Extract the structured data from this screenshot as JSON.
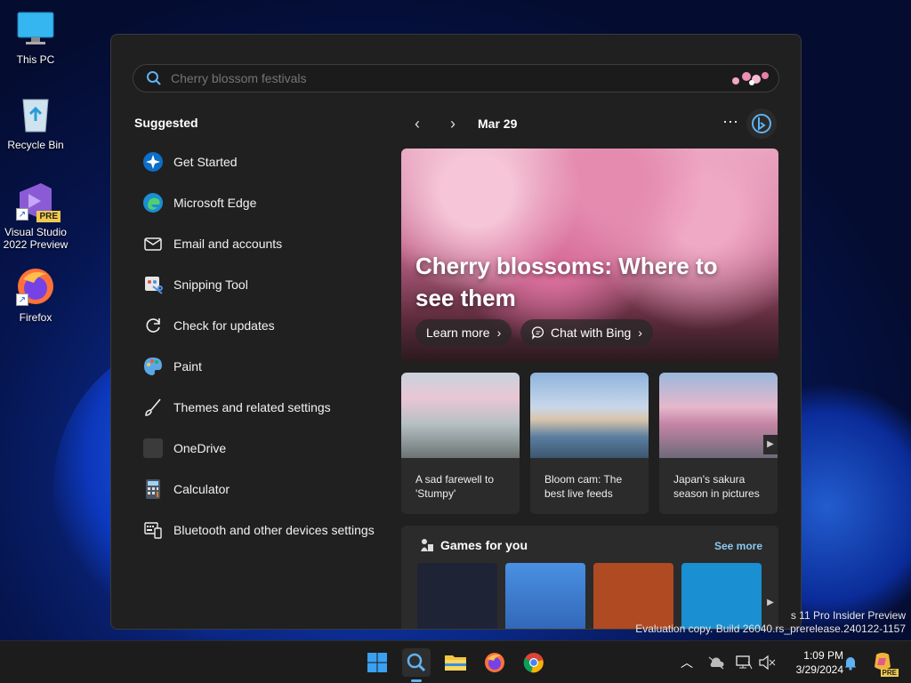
{
  "desktop": {
    "icons": [
      {
        "label": "This PC"
      },
      {
        "label": "Recycle Bin"
      },
      {
        "label": "Visual Studio 2022 Preview",
        "badge": "PRE"
      },
      {
        "label": "Firefox"
      }
    ]
  },
  "search": {
    "value": "",
    "placeholder": "Cherry blossom festivals"
  },
  "suggested": {
    "title": "Suggested",
    "items": [
      {
        "label": "Get Started",
        "icon": "get-started-icon"
      },
      {
        "label": "Microsoft Edge",
        "icon": "edge-icon"
      },
      {
        "label": "Email and accounts",
        "icon": "mail-icon"
      },
      {
        "label": "Snipping Tool",
        "icon": "snipping-tool-icon"
      },
      {
        "label": "Check for updates",
        "icon": "refresh-icon"
      },
      {
        "label": "Paint",
        "icon": "paint-icon"
      },
      {
        "label": "Themes and related settings",
        "icon": "brush-icon"
      },
      {
        "label": "OneDrive",
        "icon": "onedrive-icon"
      },
      {
        "label": "Calculator",
        "icon": "calculator-icon"
      },
      {
        "label": "Bluetooth and other devices settings",
        "icon": "devices-icon"
      }
    ]
  },
  "feed": {
    "date": "Mar 29",
    "more": "···",
    "hero": {
      "title": "Cherry blossoms: Where to see them",
      "learn_more": "Learn more",
      "chat_with_bing": "Chat with Bing"
    },
    "cards": [
      {
        "caption": "A sad farewell to 'Stumpy'"
      },
      {
        "caption": "Bloom cam: The best live feeds"
      },
      {
        "caption": "Japan's sakura season in pictures"
      }
    ],
    "games": {
      "title": "Games for you",
      "see_more": "See more",
      "tile_colors": [
        "#1f2336",
        "#3a7bd5",
        "#b04a22",
        "#1a8fd1"
      ]
    }
  },
  "watermark": {
    "line1": "s 11 Pro Insider Preview",
    "line2": "Evaluation copy. Build 26040.rs_prerelease.240122-1157"
  },
  "taskbar": {
    "time": "1:09 PM",
    "date": "3/29/2024",
    "copilot_badge": "PRE"
  },
  "colors": {
    "accent": "#5fb2f2",
    "panel": "#202020",
    "see_more": "#8ac8f2"
  }
}
